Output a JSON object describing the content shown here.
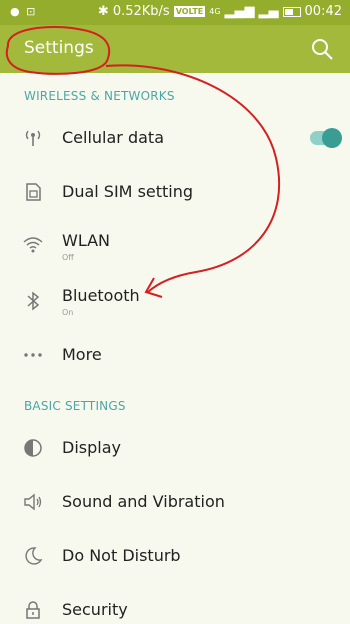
{
  "status_bar": {
    "speed": "0.52Kb/s",
    "volte_badge": "VOLTE",
    "network_small": "4G",
    "time": "00:42"
  },
  "app_bar": {
    "title": "Settings"
  },
  "sections": {
    "wireless": {
      "header": "WIRELESS & NETWORKS",
      "items": [
        {
          "label": "Cellular data",
          "toggle_on": true
        },
        {
          "label": "Dual SIM setting"
        },
        {
          "label": "WLAN",
          "sub": "Off"
        },
        {
          "label": "Bluetooth",
          "sub": "On"
        },
        {
          "label": "More"
        }
      ]
    },
    "basic": {
      "header": "BASIC SETTINGS",
      "items": [
        {
          "label": "Display"
        },
        {
          "label": "Sound and Vibration"
        },
        {
          "label": "Do Not Disturb"
        },
        {
          "label": "Security"
        }
      ]
    }
  },
  "colors": {
    "status_bar": "#95ad2c",
    "app_bar": "#a3b93b",
    "accent": "#4ba6a6",
    "annotation": "#d42020"
  }
}
